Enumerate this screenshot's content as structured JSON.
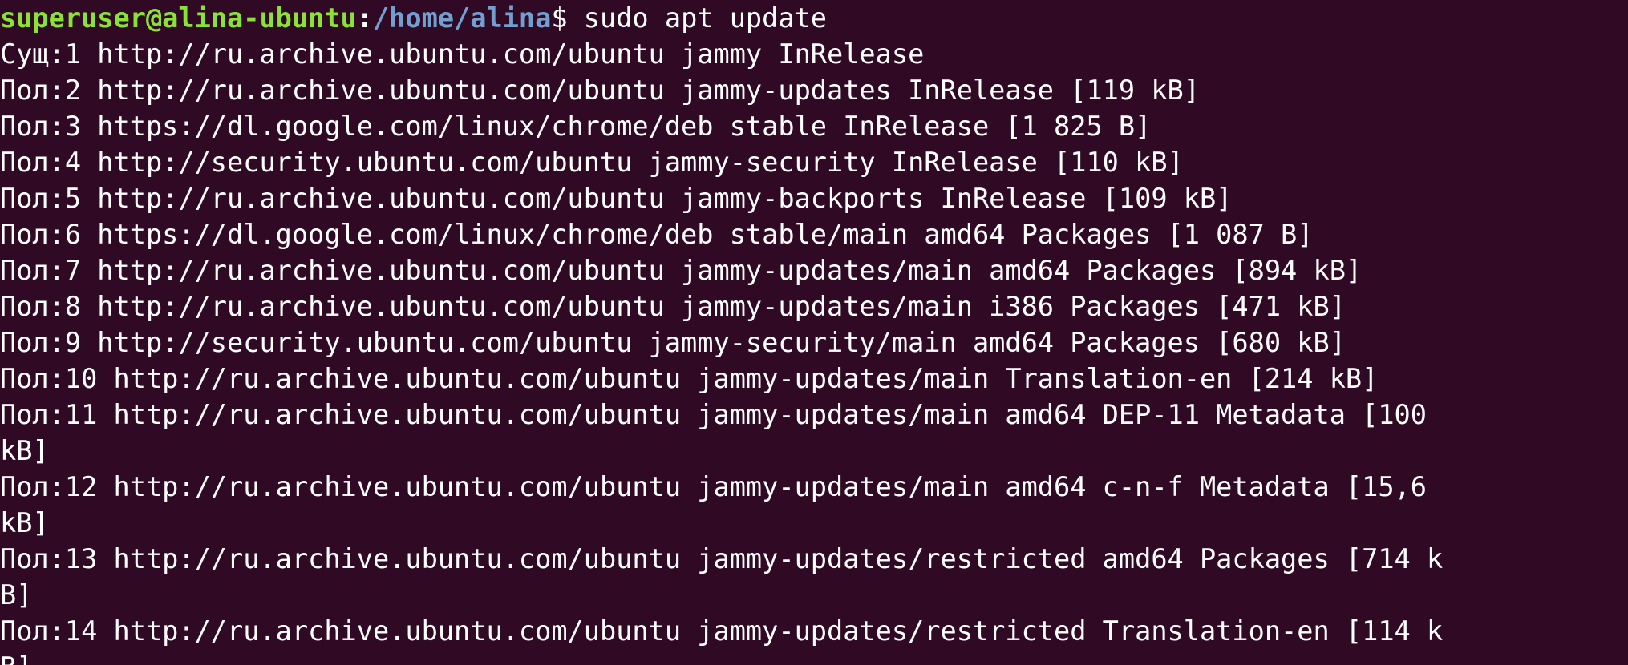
{
  "prompt": {
    "user_host": "superuser@alina-ubuntu",
    "separator": ":",
    "path": "/home/alina",
    "sign": "$",
    "command": " sudo apt update"
  },
  "output_lines": [
    "Сущ:1 http://ru.archive.ubuntu.com/ubuntu jammy InRelease",
    "Пол:2 http://ru.archive.ubuntu.com/ubuntu jammy-updates InRelease [119 kB]",
    "Пол:3 https://dl.google.com/linux/chrome/deb stable InRelease [1 825 B]",
    "Пол:4 http://security.ubuntu.com/ubuntu jammy-security InRelease [110 kB]",
    "Пол:5 http://ru.archive.ubuntu.com/ubuntu jammy-backports InRelease [109 kB]",
    "Пол:6 https://dl.google.com/linux/chrome/deb stable/main amd64 Packages [1 087 B]",
    "Пол:7 http://ru.archive.ubuntu.com/ubuntu jammy-updates/main amd64 Packages [894 kB]",
    "Пол:8 http://ru.archive.ubuntu.com/ubuntu jammy-updates/main i386 Packages [471 kB]",
    "Пол:9 http://security.ubuntu.com/ubuntu jammy-security/main amd64 Packages [680 kB]",
    "Пол:10 http://ru.archive.ubuntu.com/ubuntu jammy-updates/main Translation-en [214 kB]",
    "Пол:11 http://ru.archive.ubuntu.com/ubuntu jammy-updates/main amd64 DEP-11 Metadata [100",
    "kB]",
    "Пол:12 http://ru.archive.ubuntu.com/ubuntu jammy-updates/main amd64 c-n-f Metadata [15,6",
    "kB]",
    "Пол:13 http://ru.archive.ubuntu.com/ubuntu jammy-updates/restricted amd64 Packages [714 k",
    "B]",
    "Пол:14 http://ru.archive.ubuntu.com/ubuntu jammy-updates/restricted Translation-en [114 k",
    "B]"
  ],
  "colors": {
    "background": "#300a24",
    "text": "#ffffff",
    "user_host": "#8ae234",
    "path": "#729fcf"
  }
}
